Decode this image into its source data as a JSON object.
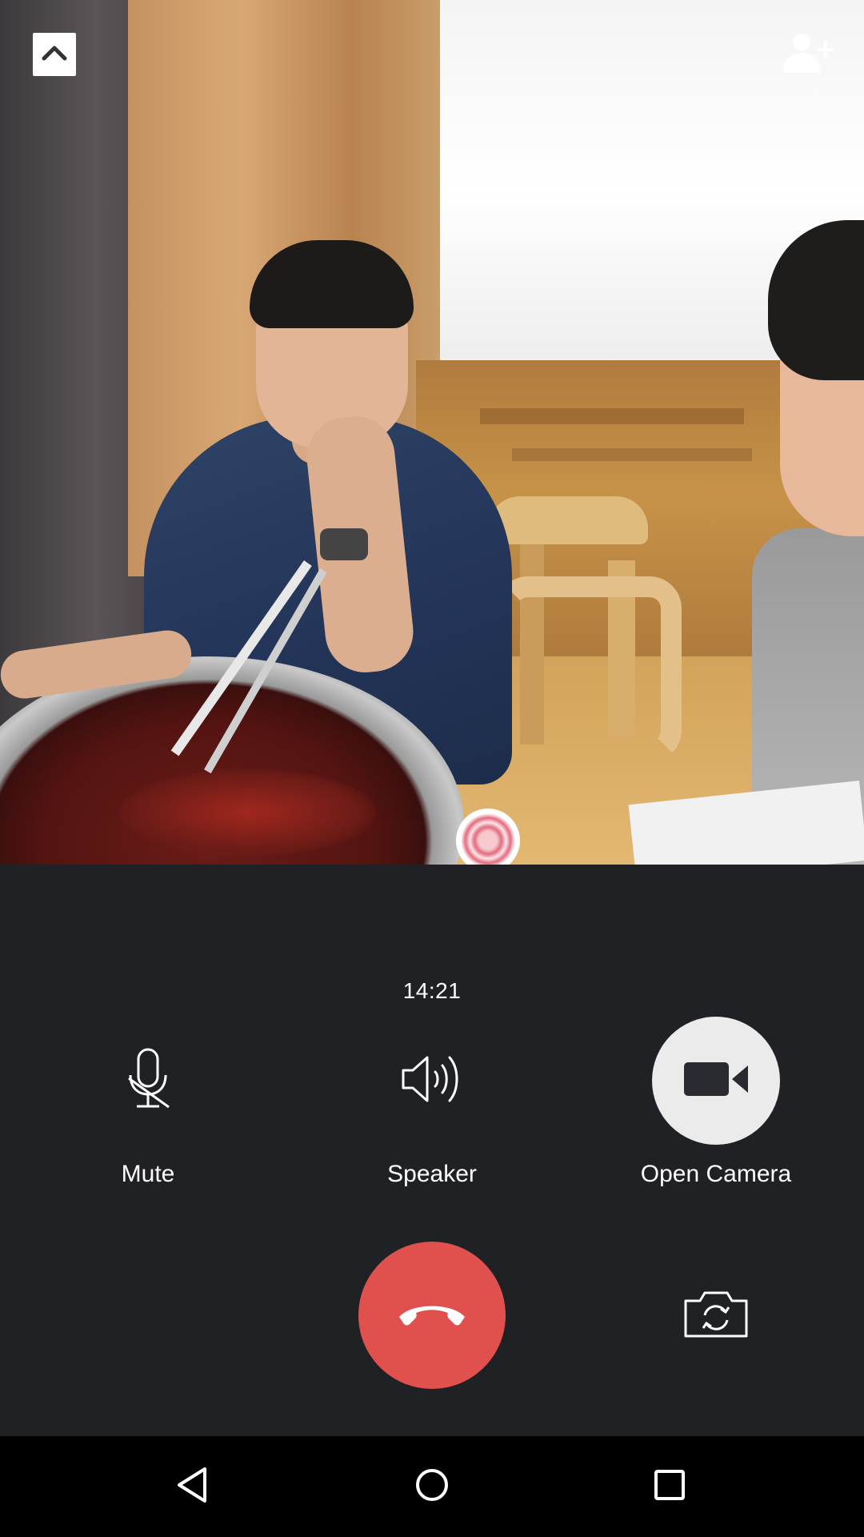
{
  "call": {
    "duration": "14:21",
    "controls": {
      "mute_label": "Mute",
      "speaker_label": "Speaker",
      "camera_label": "Open Camera"
    }
  },
  "icons": {
    "minimize": "chevron-up-icon",
    "add_member": "add-person-icon",
    "mute": "microphone-off-icon",
    "speaker": "speaker-icon",
    "camera": "video-camera-icon",
    "hangup": "phone-hangup-icon",
    "switch_camera": "switch-camera-icon",
    "nav_back": "triangle-back-icon",
    "nav_home": "circle-home-icon",
    "nav_recent": "square-recents-icon"
  },
  "colors": {
    "background": "#202125",
    "hangup": "#e0504d",
    "camera_button": "#ebebeb",
    "text": "#ffffff",
    "navbar": "#000000"
  }
}
